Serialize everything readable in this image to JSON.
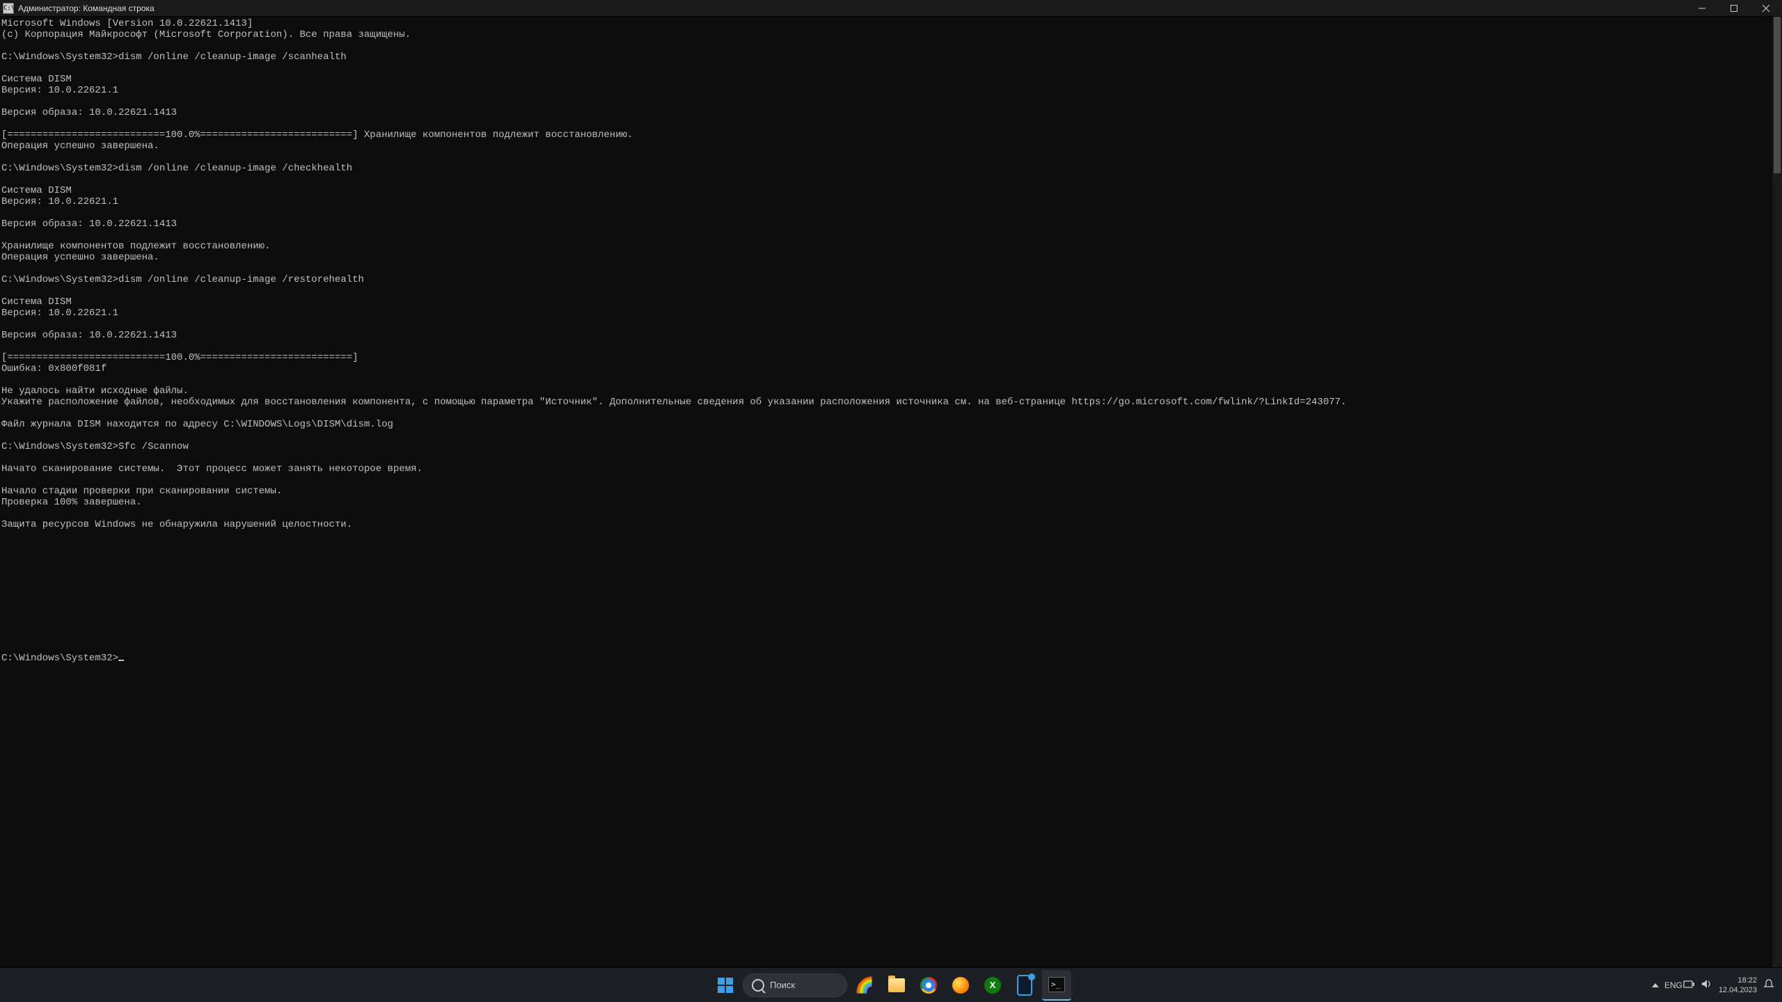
{
  "window": {
    "title": "Администратор: Командная строка"
  },
  "terminal_lines": [
    "Microsoft Windows [Version 10.0.22621.1413]",
    "(c) Корпорация Майкрософт (Microsoft Corporation). Все права защищены.",
    "",
    "C:\\Windows\\System32>dism /online /cleanup-image /scanhealth",
    "",
    "Cистема DISM",
    "Версия: 10.0.22621.1",
    "",
    "Версия образа: 10.0.22621.1413",
    "",
    "[===========================100.0%==========================] Хранилище компонентов подлежит восстановлению.",
    "Операция успешно завершена.",
    "",
    "C:\\Windows\\System32>dism /online /cleanup-image /checkhealth",
    "",
    "Cистема DISM",
    "Версия: 10.0.22621.1",
    "",
    "Версия образа: 10.0.22621.1413",
    "",
    "Хранилище компонентов подлежит восстановлению.",
    "Операция успешно завершена.",
    "",
    "C:\\Windows\\System32>dism /online /cleanup-image /restorehealth",
    "",
    "Cистема DISM",
    "Версия: 10.0.22621.1",
    "",
    "Версия образа: 10.0.22621.1413",
    "",
    "[===========================100.0%==========================]",
    "Ошибка: 0x800f081f",
    "",
    "Не удалось найти исходные файлы.",
    "Укажите расположение файлов, необходимых для восстановления компонента, с помощью параметра \"Источник\". Дополнительные сведения об указании расположения источника см. на веб-странице https://go.microsoft.com/fwlink/?LinkId=243077.",
    "",
    "Файл журнала DISM находится по адресу C:\\WINDOWS\\Logs\\DISM\\dism.log",
    "",
    "C:\\Windows\\System32>Sfc /Scannow",
    "",
    "Начато сканирование системы.  Этот процесс может занять некоторое время.",
    "",
    "Начало стадии проверки при сканировании системы.",
    "Проверка 100% завершена.",
    "",
    "Защита ресурсов Windows не обнаружила нарушений целостности.",
    "",
    "",
    "",
    "",
    "",
    "",
    "",
    "",
    "",
    "",
    ""
  ],
  "prompt": "C:\\Windows\\System32>",
  "taskbar": {
    "search_placeholder": "Поиск",
    "lang": "ENG",
    "time": "18:22",
    "date": "12.04.2023"
  }
}
